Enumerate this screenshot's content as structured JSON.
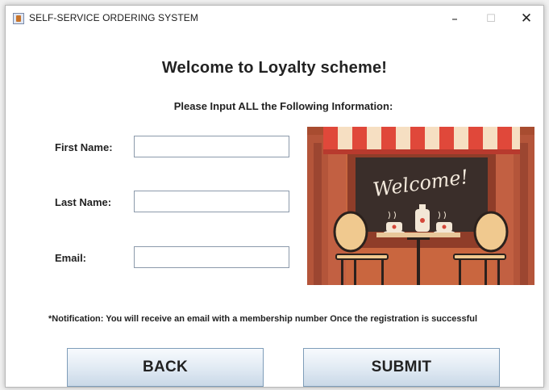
{
  "window": {
    "title": "SELF-SERVICE ORDERING SYSTEM",
    "minimize": "–",
    "maximize": "☐",
    "close": "✕"
  },
  "form": {
    "heading": "Welcome to Loyalty scheme!",
    "subheading": "Please Input ALL the Following Information:",
    "first_name_label": "First Name:",
    "first_name_value": "",
    "last_name_label": "Last Name:",
    "last_name_value": "",
    "email_label": "Email:",
    "email_value": ""
  },
  "image": {
    "icon": "cafe-welcome-illustration",
    "sign_text": "Welcome!"
  },
  "notification": "*Notification: You will receive an email  with a membership number Once the registration is successful",
  "buttons": {
    "back": "BACK",
    "submit": "SUBMIT"
  },
  "colors": {
    "awning_red": "#e0483a",
    "awning_cream": "#f6dfc2",
    "wall_orange": "#cb6a42",
    "board_dark": "#3a2e2a",
    "button_border": "#7f9db9"
  }
}
